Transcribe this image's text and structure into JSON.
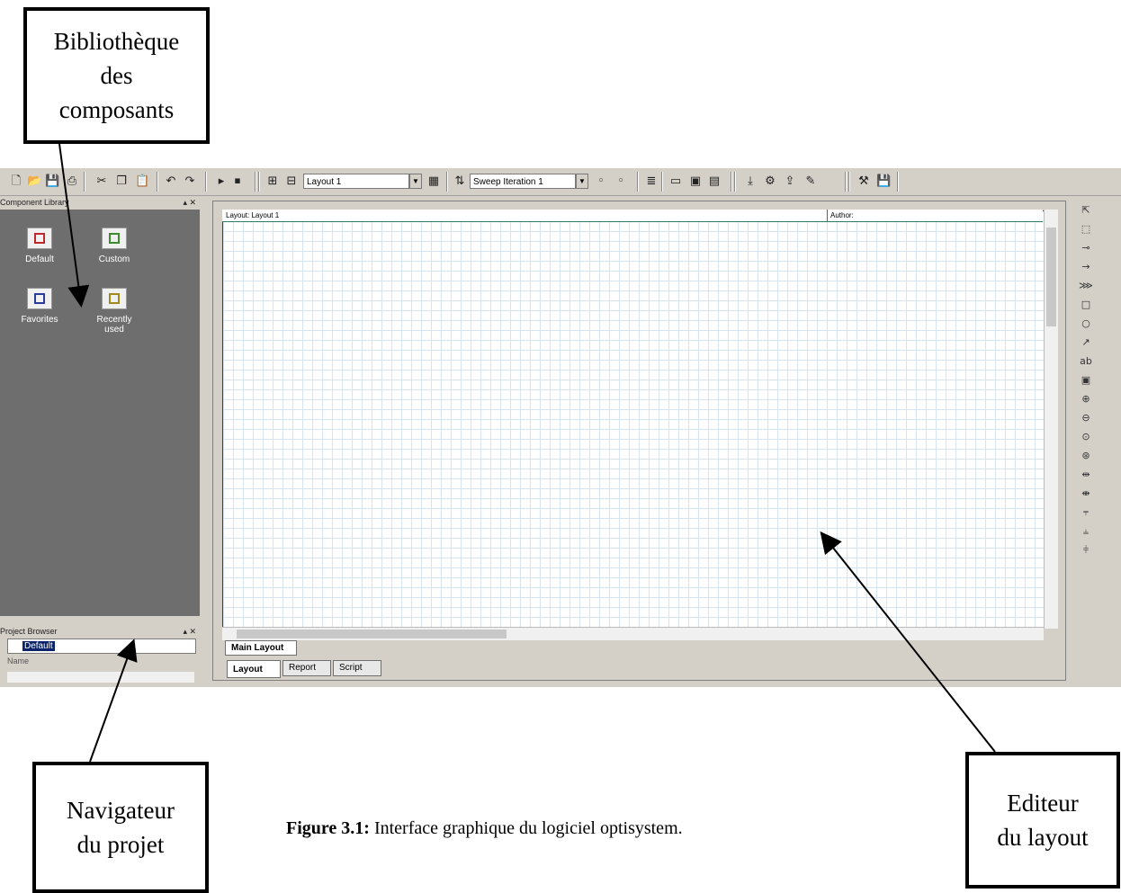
{
  "callouts": {
    "library": "Bibliothèque\ndes\ncomposants",
    "navigator": "Navigateur\ndu projet",
    "editor": "Editeur\ndu layout"
  },
  "caption": {
    "label": "Figure 3.1:",
    "text": " Interface graphique du logiciel optisystem."
  },
  "toolbar": {
    "layout_combo": "Layout 1",
    "sweep_combo": "Sweep Iteration 1"
  },
  "component_library": {
    "title": "Component Library",
    "items": [
      {
        "label": "Default",
        "color": "#c0282d"
      },
      {
        "label": "Custom",
        "color": "#3c8a2e"
      },
      {
        "label": "Favorites",
        "color": "#2a3a9a"
      },
      {
        "label": "Recently used",
        "color": "#a08a1e"
      }
    ]
  },
  "project_browser": {
    "title": "Project Browser",
    "selected": "Default",
    "column": "Name"
  },
  "editor": {
    "layout_header": "Layout: Layout 1",
    "author_header": "Author:",
    "main_tab": "Main Layout",
    "bottom_tabs": [
      "Layout",
      "Report",
      "Script"
    ]
  }
}
